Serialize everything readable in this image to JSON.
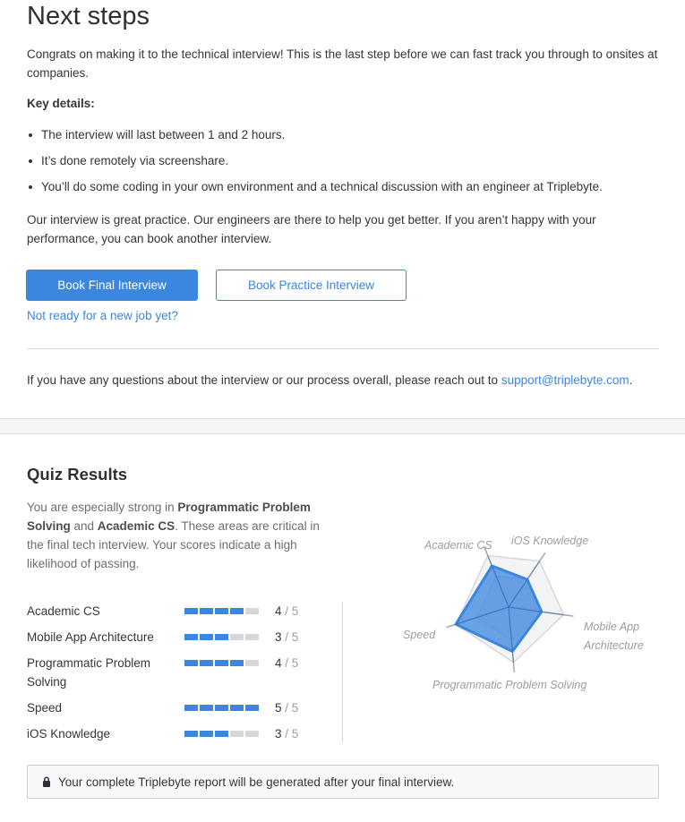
{
  "next_steps": {
    "title": "Next steps",
    "intro": "Congrats on making it to the technical interview! This is the last step before we can fast track you through to onsites at companies.",
    "key_details_label": "Key details:",
    "bullets": [
      "The interview will last between 1 and 2 hours.",
      "It’s done remotely via screenshare.",
      "You’ll do some coding in your own environment and a technical discussion with an engineer at Triplebyte."
    ],
    "practice_text": "Our interview is great practice. Our engineers are there to help you get better. If you aren’t happy with your performance, you can book another interview.",
    "primary_button": "Book Final Interview",
    "secondary_button": "Book Practice Interview",
    "not_ready_link": "Not ready for a new job yet?",
    "questions_text": "If you have any questions about the interview or our process overall, please reach out to ",
    "support_email": "support@triplebyte.com",
    "questions_end": "."
  },
  "quiz": {
    "title": "Quiz Results",
    "summary_1": "You are especially strong in ",
    "strong_1": "Programmatic Problem Solving",
    "summary_2": " and ",
    "strong_2": "Academic CS",
    "summary_3": ". These areas are critical in the final tech interview. Your scores indicate a high likelihood of passing.",
    "max_score": 5,
    "max_label": "/ 5",
    "scores": [
      {
        "label": "Academic CS",
        "score": 4,
        "score_label": "4"
      },
      {
        "label": "Mobile App Architecture",
        "score": 3,
        "score_label": "3"
      },
      {
        "label": "Programmatic Problem Solving",
        "score": 4,
        "score_label": "4"
      },
      {
        "label": "Speed",
        "score": 5,
        "score_label": "5"
      },
      {
        "label": "iOS Knowledge",
        "score": 3,
        "score_label": "3"
      }
    ],
    "radar_axes": [
      "Academic CS",
      "iOS Knowledge",
      "Mobile App",
      "Architecture",
      "Programmatic Problem Solving",
      "Speed"
    ],
    "notice_icon": "lock-icon",
    "notice": "Your complete Triplebyte report will be generated after your final interview."
  },
  "chart_data": {
    "type": "radar",
    "axes": [
      "Academic CS",
      "iOS Knowledge",
      "Mobile App Architecture",
      "Programmatic Problem Solving",
      "Speed"
    ],
    "values": [
      4,
      3,
      3,
      4,
      5
    ],
    "max": 5
  },
  "colors": {
    "accent": "#3b86df",
    "bar_off": "#d5d7da"
  }
}
